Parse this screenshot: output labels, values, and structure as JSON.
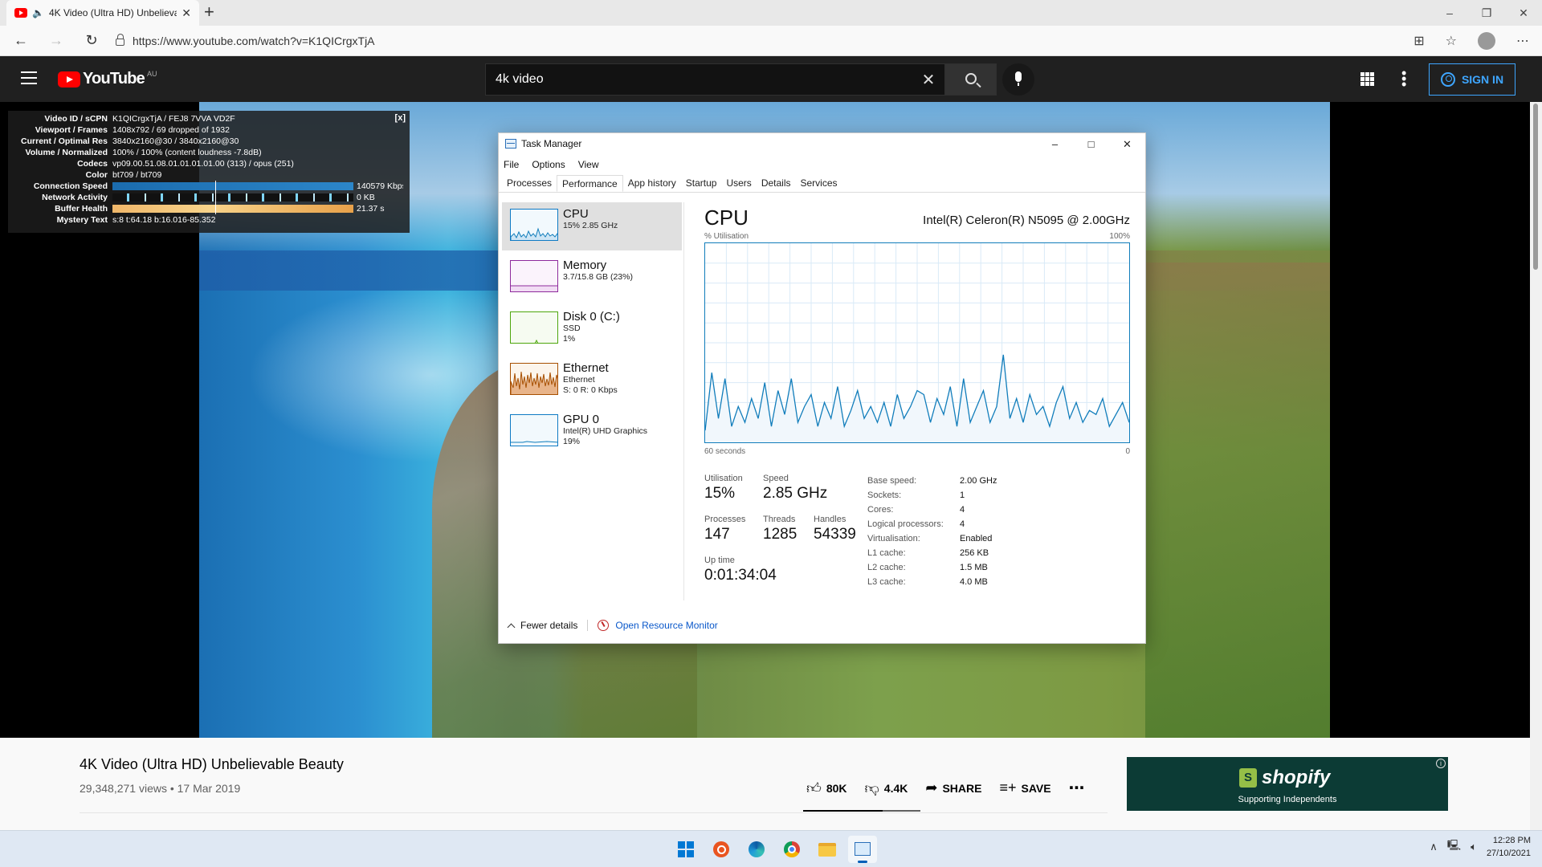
{
  "browser": {
    "tab_title": "4K Video (Ultra HD) Unbelievable Beauty",
    "url": "https://www.youtube.com/watch?v=K1QICrgxTjA"
  },
  "youtube": {
    "logo_text": "YouTube",
    "region": "AU",
    "search_value": "4k video",
    "sign_in": "SIGN IN"
  },
  "stats": {
    "rows": [
      {
        "k": "Video ID / sCPN",
        "v": "K1QICrgxTjA / FEJ8 7VVA VD2F"
      },
      {
        "k": "Viewport / Frames",
        "v": "1408x792 / 69 dropped of 1932"
      },
      {
        "k": "Current / Optimal Res",
        "v": "3840x2160@30 / 3840x2160@30"
      },
      {
        "k": "Volume / Normalized",
        "v": "100% / 100% (content loudness -7.8dB)"
      },
      {
        "k": "Codecs",
        "v": "vp09.00.51.08.01.01.01.01.00 (313) / opus (251)"
      },
      {
        "k": "Color",
        "v": "bt709 / bt709"
      }
    ],
    "connection": {
      "k": "Connection Speed",
      "v": "140579 Kbps"
    },
    "network": {
      "k": "Network Activity",
      "v": "0 KB"
    },
    "buffer": {
      "k": "Buffer Health",
      "v": "21.37 s"
    },
    "mystery": {
      "k": "Mystery Text",
      "v": "s:8 t:64.18 b:16.016-85.352"
    },
    "close": "[x]"
  },
  "taskmgr": {
    "title": "Task Manager",
    "menu": [
      "File",
      "Options",
      "View"
    ],
    "tabs": [
      "Processes",
      "Performance",
      "App history",
      "Startup",
      "Users",
      "Details",
      "Services"
    ],
    "side": [
      {
        "name": "CPU",
        "sub1": "15% 2.85 GHz",
        "sub2": "",
        "sub3": ""
      },
      {
        "name": "Memory",
        "sub1": "3.7/15.8 GB (23%)",
        "sub2": "",
        "sub3": ""
      },
      {
        "name": "Disk 0 (C:)",
        "sub1": "SSD",
        "sub2": "1%",
        "sub3": ""
      },
      {
        "name": "Ethernet",
        "sub1": "Ethernet",
        "sub2": "S: 0 R: 0 Kbps",
        "sub3": ""
      },
      {
        "name": "GPU 0",
        "sub1": "Intel(R) UHD Graphics",
        "sub2": "19%",
        "sub3": ""
      }
    ],
    "heading": "CPU",
    "model": "Intel(R) Celeron(R) N5095 @ 2.00GHz",
    "util_label": "% Utilisation",
    "max_label": "100%",
    "time_label": "60 seconds",
    "min_label": "0",
    "graph_values": [
      6,
      35,
      12,
      32,
      8,
      18,
      10,
      22,
      12,
      30,
      8,
      26,
      14,
      32,
      10,
      18,
      24,
      8,
      20,
      12,
      28,
      8,
      16,
      26,
      12,
      18,
      10,
      20,
      8,
      24,
      12,
      18,
      26,
      24,
      10,
      22,
      14,
      28,
      8,
      32,
      10,
      18,
      26,
      10,
      18,
      44,
      12,
      22,
      10,
      24,
      14,
      18,
      8,
      20,
      28,
      12,
      20,
      10,
      16,
      14,
      22,
      8,
      14,
      20,
      10
    ],
    "graph_color": "#117dbb",
    "stats": {
      "utilisation": {
        "label": "Utilisation",
        "value": "15%"
      },
      "speed": {
        "label": "Speed",
        "value": "2.85 GHz"
      },
      "processes": {
        "label": "Processes",
        "value": "147"
      },
      "threads": {
        "label": "Threads",
        "value": "1285"
      },
      "handles": {
        "label": "Handles",
        "value": "54339"
      },
      "uptime": {
        "label": "Up time",
        "value": "0:01:34:04"
      }
    },
    "specs": [
      {
        "k": "Base speed:",
        "v": "2.00 GHz"
      },
      {
        "k": "Sockets:",
        "v": "1"
      },
      {
        "k": "Cores:",
        "v": "4"
      },
      {
        "k": "Logical processors:",
        "v": "4"
      },
      {
        "k": "Virtualisation:",
        "v": "Enabled"
      },
      {
        "k": "L1 cache:",
        "v": "256 KB"
      },
      {
        "k": "L2 cache:",
        "v": "1.5 MB"
      },
      {
        "k": "L3 cache:",
        "v": "4.0 MB"
      }
    ],
    "fewer_details": "Fewer details",
    "resource_monitor": "Open Resource Monitor"
  },
  "video": {
    "title": "4K Video (Ultra HD) Unbelievable Beauty",
    "meta": "29,348,271 views • 17 Mar 2019",
    "likes": "80K",
    "dislikes": "4.4K",
    "share": "SHARE",
    "save": "SAVE",
    "like_ratio": 0.68
  },
  "ad": {
    "brand": "shopify",
    "tagline": "Supporting Independents"
  },
  "taskbar": {
    "time": "12:28 PM",
    "date": "27/10/2021"
  }
}
